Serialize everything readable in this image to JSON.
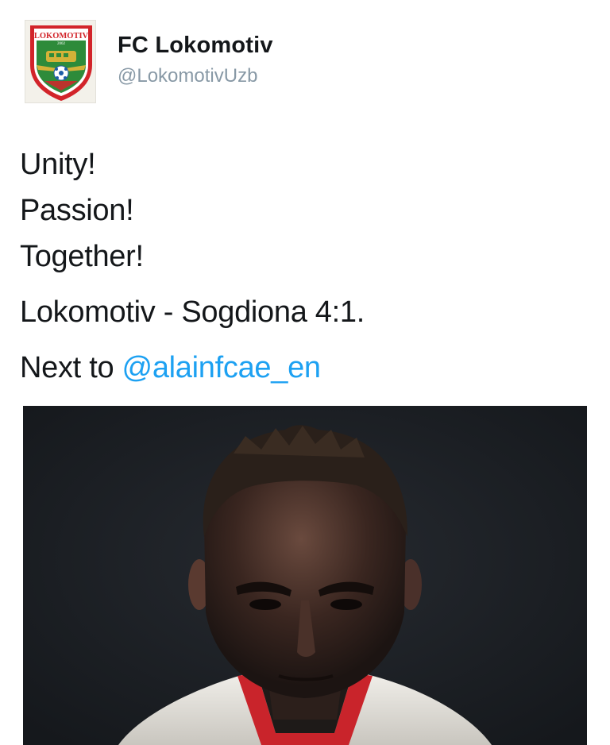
{
  "account": {
    "display_name": "FC Lokomotiv",
    "handle": "@LokomotivUzb",
    "avatar": {
      "icon": "club-crest-icon",
      "crest_text": "LOKOMOTIV",
      "crest_year": "2002",
      "colors": {
        "green": "#2e8b3a",
        "red": "#d2242a",
        "gold": "#d4b238"
      }
    }
  },
  "tweet": {
    "lines": [
      "Unity!",
      "Passion!",
      "Together!"
    ],
    "score_line": "Lokomotiv - Sogdiona 4:1.",
    "next_prefix": "Next to ",
    "mention": "@alainfcae_en",
    "mention_color": "#1da1f2"
  },
  "media": {
    "type": "photo",
    "subject": "player-portrait",
    "colors": {
      "background": "#1d2024",
      "shirt": "#e8e6e1",
      "collar": "#c9242b"
    }
  }
}
